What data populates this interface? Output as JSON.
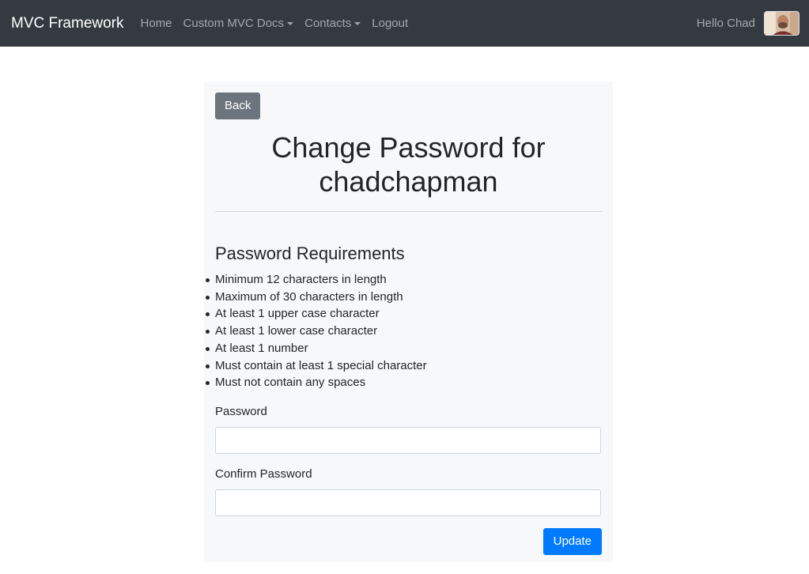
{
  "nav": {
    "brand": "MVC Framework",
    "links": [
      "Home",
      "Custom MVC Docs",
      "Contacts",
      "Logout"
    ],
    "greeting": "Hello Chad"
  },
  "form": {
    "back_label": "Back",
    "title_line1": "Change Password for",
    "title_line2": "chadchapman",
    "requirements_heading": "Password Requirements",
    "requirements": [
      "Minimum 12 characters in length",
      "Maximum of 30 characters in length",
      "At least 1 upper case character",
      "At least 1 lower case character",
      "At least 1 number",
      "Must contain at least 1 special character",
      "Must not contain any spaces"
    ],
    "password_label": "Password",
    "password_value": "",
    "confirm_label": "Confirm Password",
    "confirm_value": "",
    "update_label": "Update"
  },
  "colors": {
    "navbar": "#343a40",
    "primary": "#007bff",
    "secondary": "#6c757d"
  }
}
